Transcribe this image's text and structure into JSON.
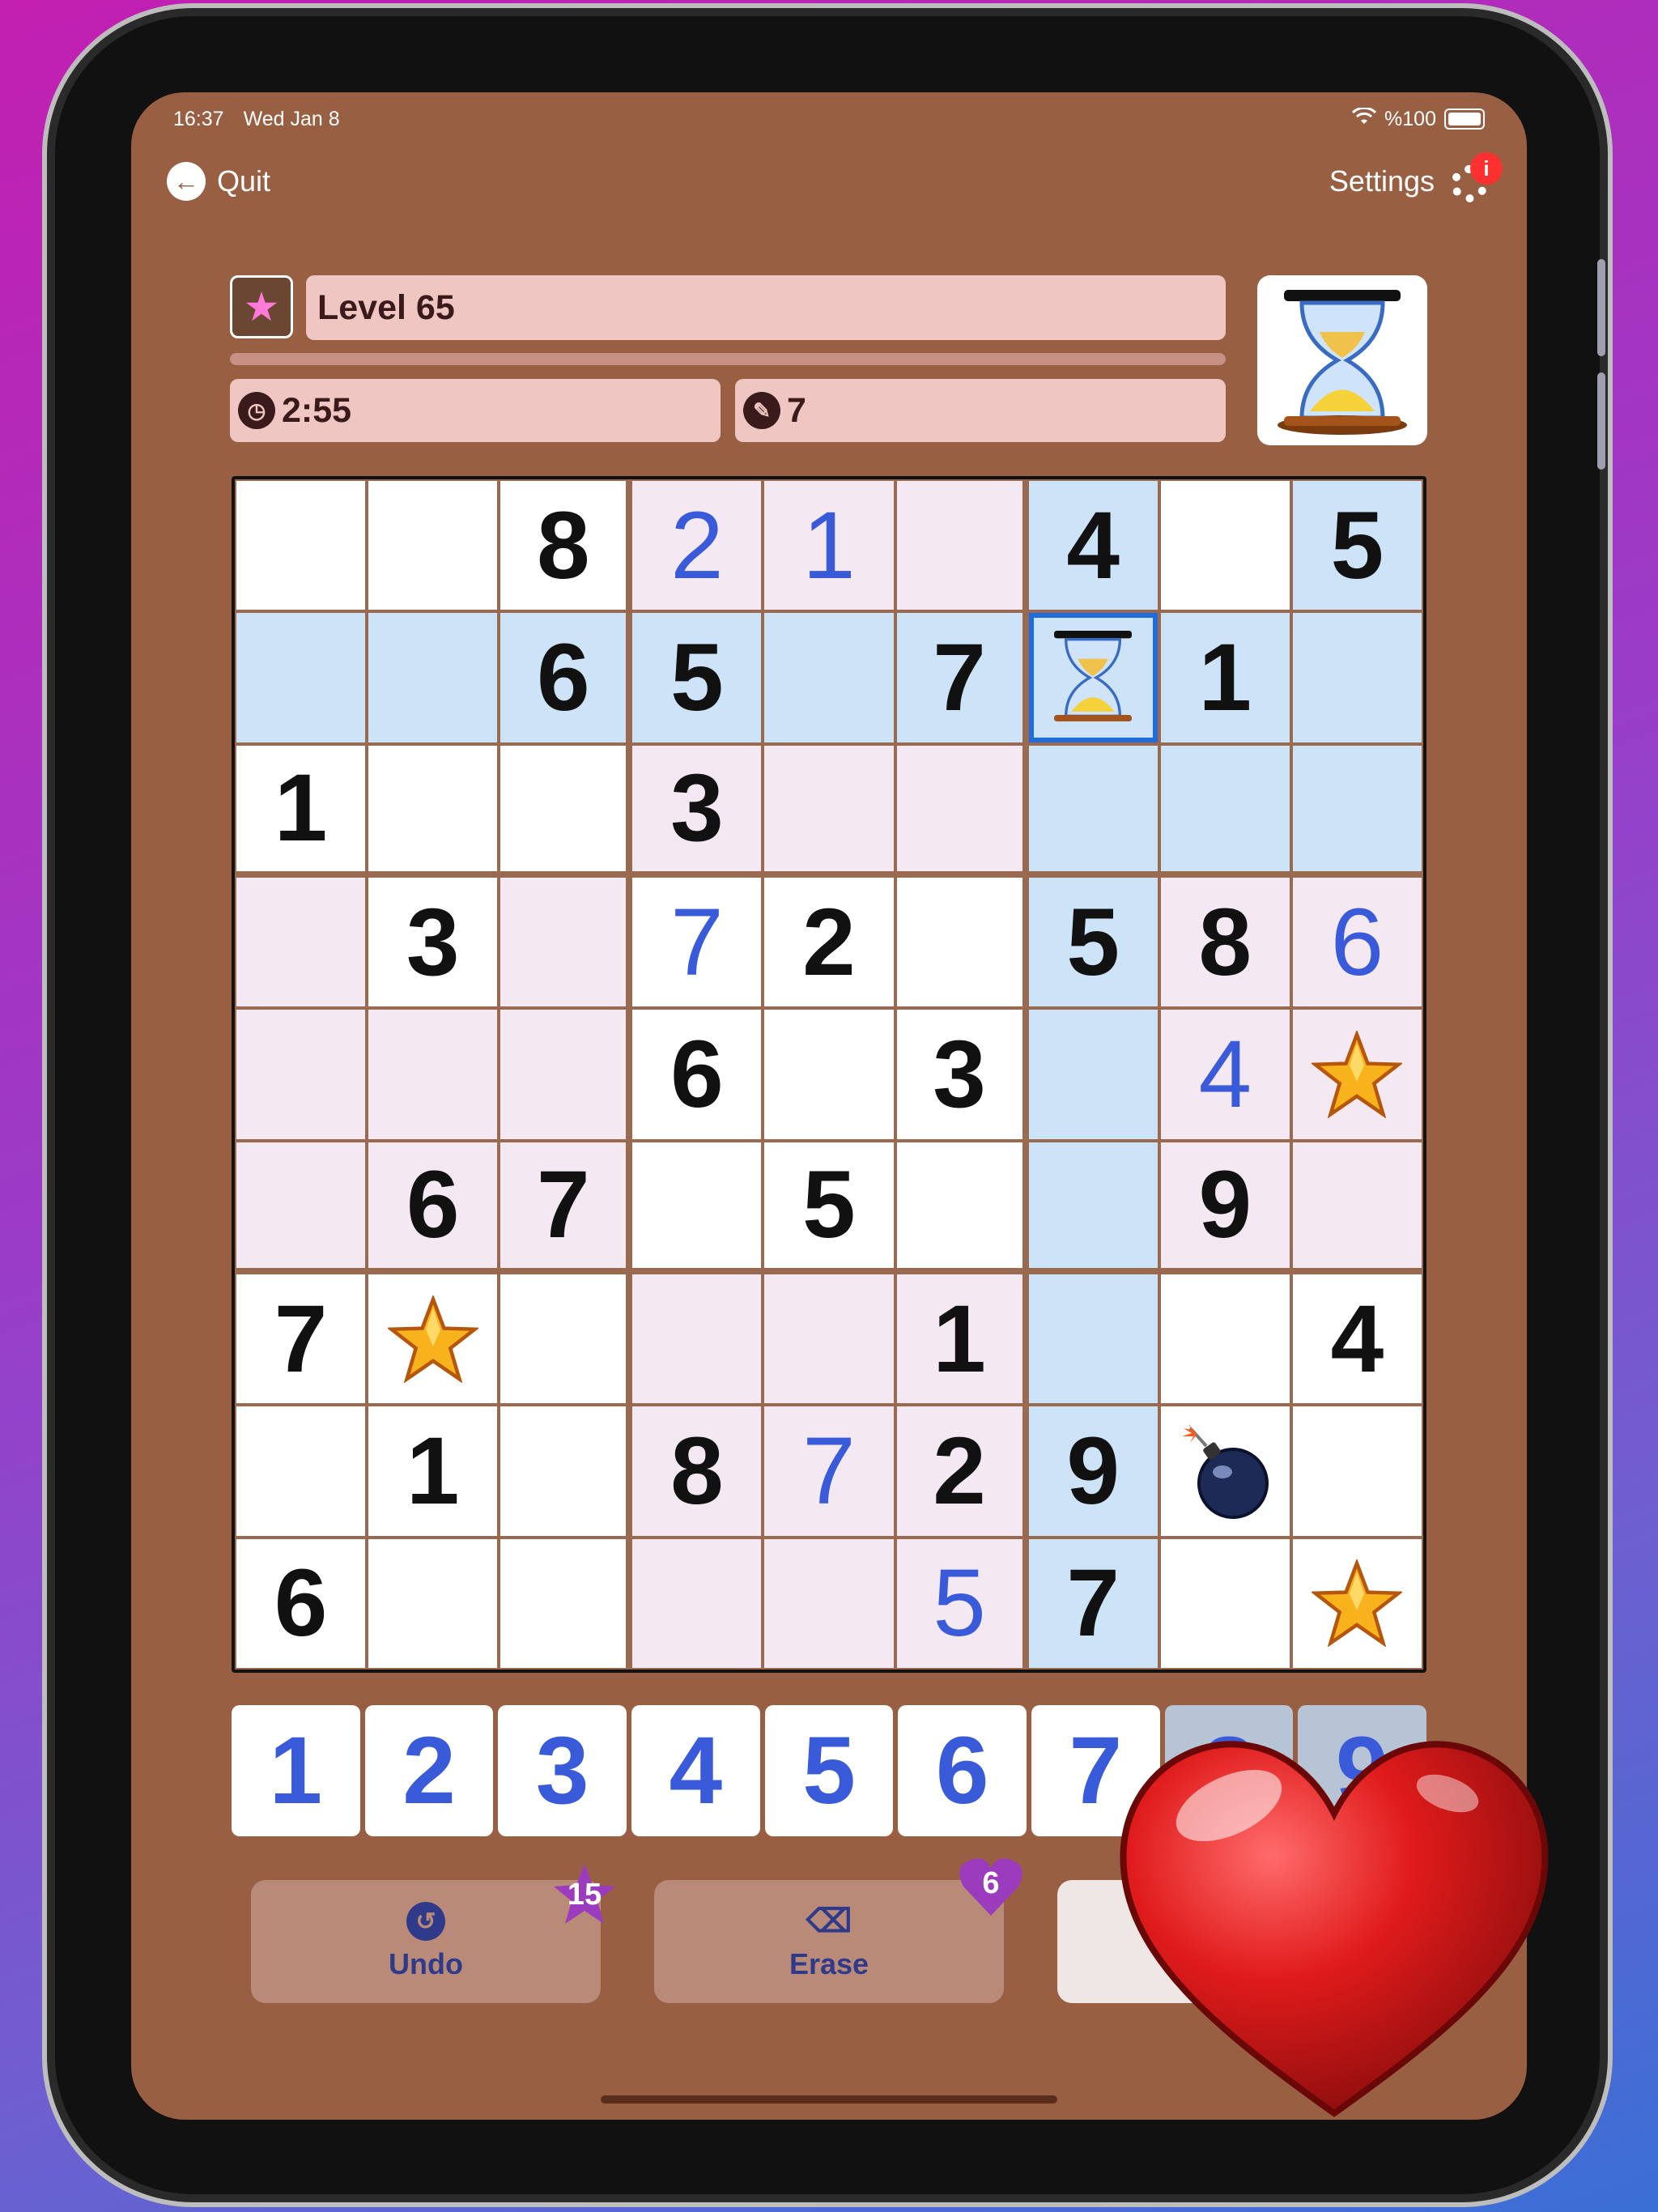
{
  "status": {
    "time": "16:37",
    "date": "Wed Jan 8",
    "battery": "%100"
  },
  "topbar": {
    "quit_label": "Quit",
    "settings_label": "Settings",
    "notification_badge": "i"
  },
  "level": {
    "title": "Level 65",
    "timer": "2:55",
    "notes_count": "7"
  },
  "board": [
    [
      "",
      "",
      "8",
      "2",
      "1",
      "",
      "4",
      "",
      "5"
    ],
    [
      "",
      "",
      "6",
      "5",
      "",
      "7",
      "hourglass",
      "1",
      ""
    ],
    [
      "1",
      "",
      "",
      "3",
      "",
      "",
      "",
      "",
      ""
    ],
    [
      "",
      "3",
      "",
      "7",
      "2",
      "",
      "5",
      "8",
      "6"
    ],
    [
      "",
      "",
      "",
      "6",
      "",
      "3",
      "",
      "4",
      "star"
    ],
    [
      "",
      "6",
      "7",
      "",
      "5",
      "",
      "",
      "9",
      ""
    ],
    [
      "7",
      "star",
      "",
      "",
      "",
      "1",
      "",
      "",
      "4"
    ],
    [
      "",
      "1",
      "",
      "8",
      "7",
      "2",
      "9",
      "bomb",
      ""
    ],
    [
      "6",
      "",
      "",
      "",
      "",
      "5",
      "7",
      "",
      "star"
    ]
  ],
  "numpad": [
    "1",
    "2",
    "3",
    "4",
    "5",
    "6",
    "7",
    "8",
    "9"
  ],
  "actions": {
    "undo_label": "Undo",
    "undo_count": "15",
    "erase_label": "Erase",
    "erase_count": "6"
  },
  "colors": {
    "background": "#995f42",
    "cell_blue": "#cde3f8",
    "cell_pink": "#f4e8f2",
    "user_digit": "#3a5bd9"
  }
}
